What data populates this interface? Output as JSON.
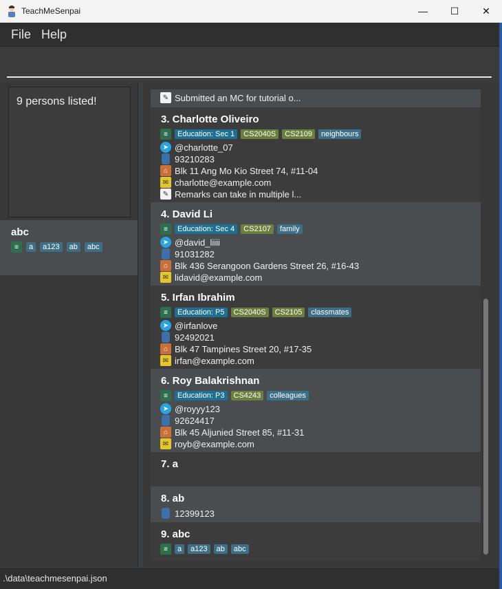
{
  "window": {
    "title": "TeachMeSenpai",
    "min_glyph": "—",
    "max_glyph": "☐",
    "close_glyph": "✕"
  },
  "menu": {
    "file": "File",
    "help": "Help"
  },
  "result": {
    "text": "9 persons listed!"
  },
  "tagged_card": {
    "name": "abc",
    "tags": [
      "a",
      "a123",
      "ab",
      "abc"
    ]
  },
  "list": {
    "top_partial_remark": "Submitted an MC for tutorial o...",
    "persons": [
      {
        "name": "3.  Charlotte Oliveiro",
        "tags": [
          {
            "label": "Education: Sec 1",
            "kind": "edu"
          },
          {
            "label": "CS2040S",
            "kind": "mod"
          },
          {
            "label": "CS2109",
            "kind": "mod"
          },
          {
            "label": "neighbours",
            "kind": "grp"
          }
        ],
        "telegram": "@charlotte_07",
        "phone": "93210283",
        "address": "Blk 11 Ang Mo Kio Street 74, #11-04",
        "email": "charlotte@example.com",
        "remark": "Remarks can take in multiple l..."
      },
      {
        "name": "4.  David Li",
        "tags": [
          {
            "label": "Education: Sec 4",
            "kind": "edu"
          },
          {
            "label": "CS2107",
            "kind": "mod"
          },
          {
            "label": "family",
            "kind": "grp"
          }
        ],
        "telegram": "@david_liiii",
        "phone": "91031282",
        "address": "Blk 436 Serangoon Gardens Street 26, #16-43",
        "email": "lidavid@example.com"
      },
      {
        "name": "5.  Irfan Ibrahim",
        "tags": [
          {
            "label": "Education: P5",
            "kind": "edu"
          },
          {
            "label": "CS2040S",
            "kind": "mod"
          },
          {
            "label": "CS2105",
            "kind": "mod"
          },
          {
            "label": "classmates",
            "kind": "grp"
          }
        ],
        "telegram": "@irfanlove",
        "phone": "92492021",
        "address": "Blk 47 Tampines Street 20, #17-35",
        "email": "irfan@example.com"
      },
      {
        "name": "6.  Roy Balakrishnan",
        "tags": [
          {
            "label": "Education: P3",
            "kind": "edu"
          },
          {
            "label": "CS4243",
            "kind": "mod"
          },
          {
            "label": "colleagues",
            "kind": "grp"
          }
        ],
        "telegram": "@royyy123",
        "phone": "92624417",
        "address": "Blk 45 Aljunied Street 85, #11-31",
        "email": "royb@example.com"
      },
      {
        "name": "7.  a"
      },
      {
        "name": "8.  ab",
        "phone": "12399123"
      },
      {
        "name": "9.  abc",
        "tags": [
          {
            "label": "a",
            "kind": "grp"
          },
          {
            "label": "a123",
            "kind": "grp"
          },
          {
            "label": "ab",
            "kind": "grp"
          },
          {
            "label": "abc",
            "kind": "grp"
          }
        ]
      }
    ]
  },
  "status": {
    "file_path": ".\\data\\teachmesenpai.json"
  }
}
